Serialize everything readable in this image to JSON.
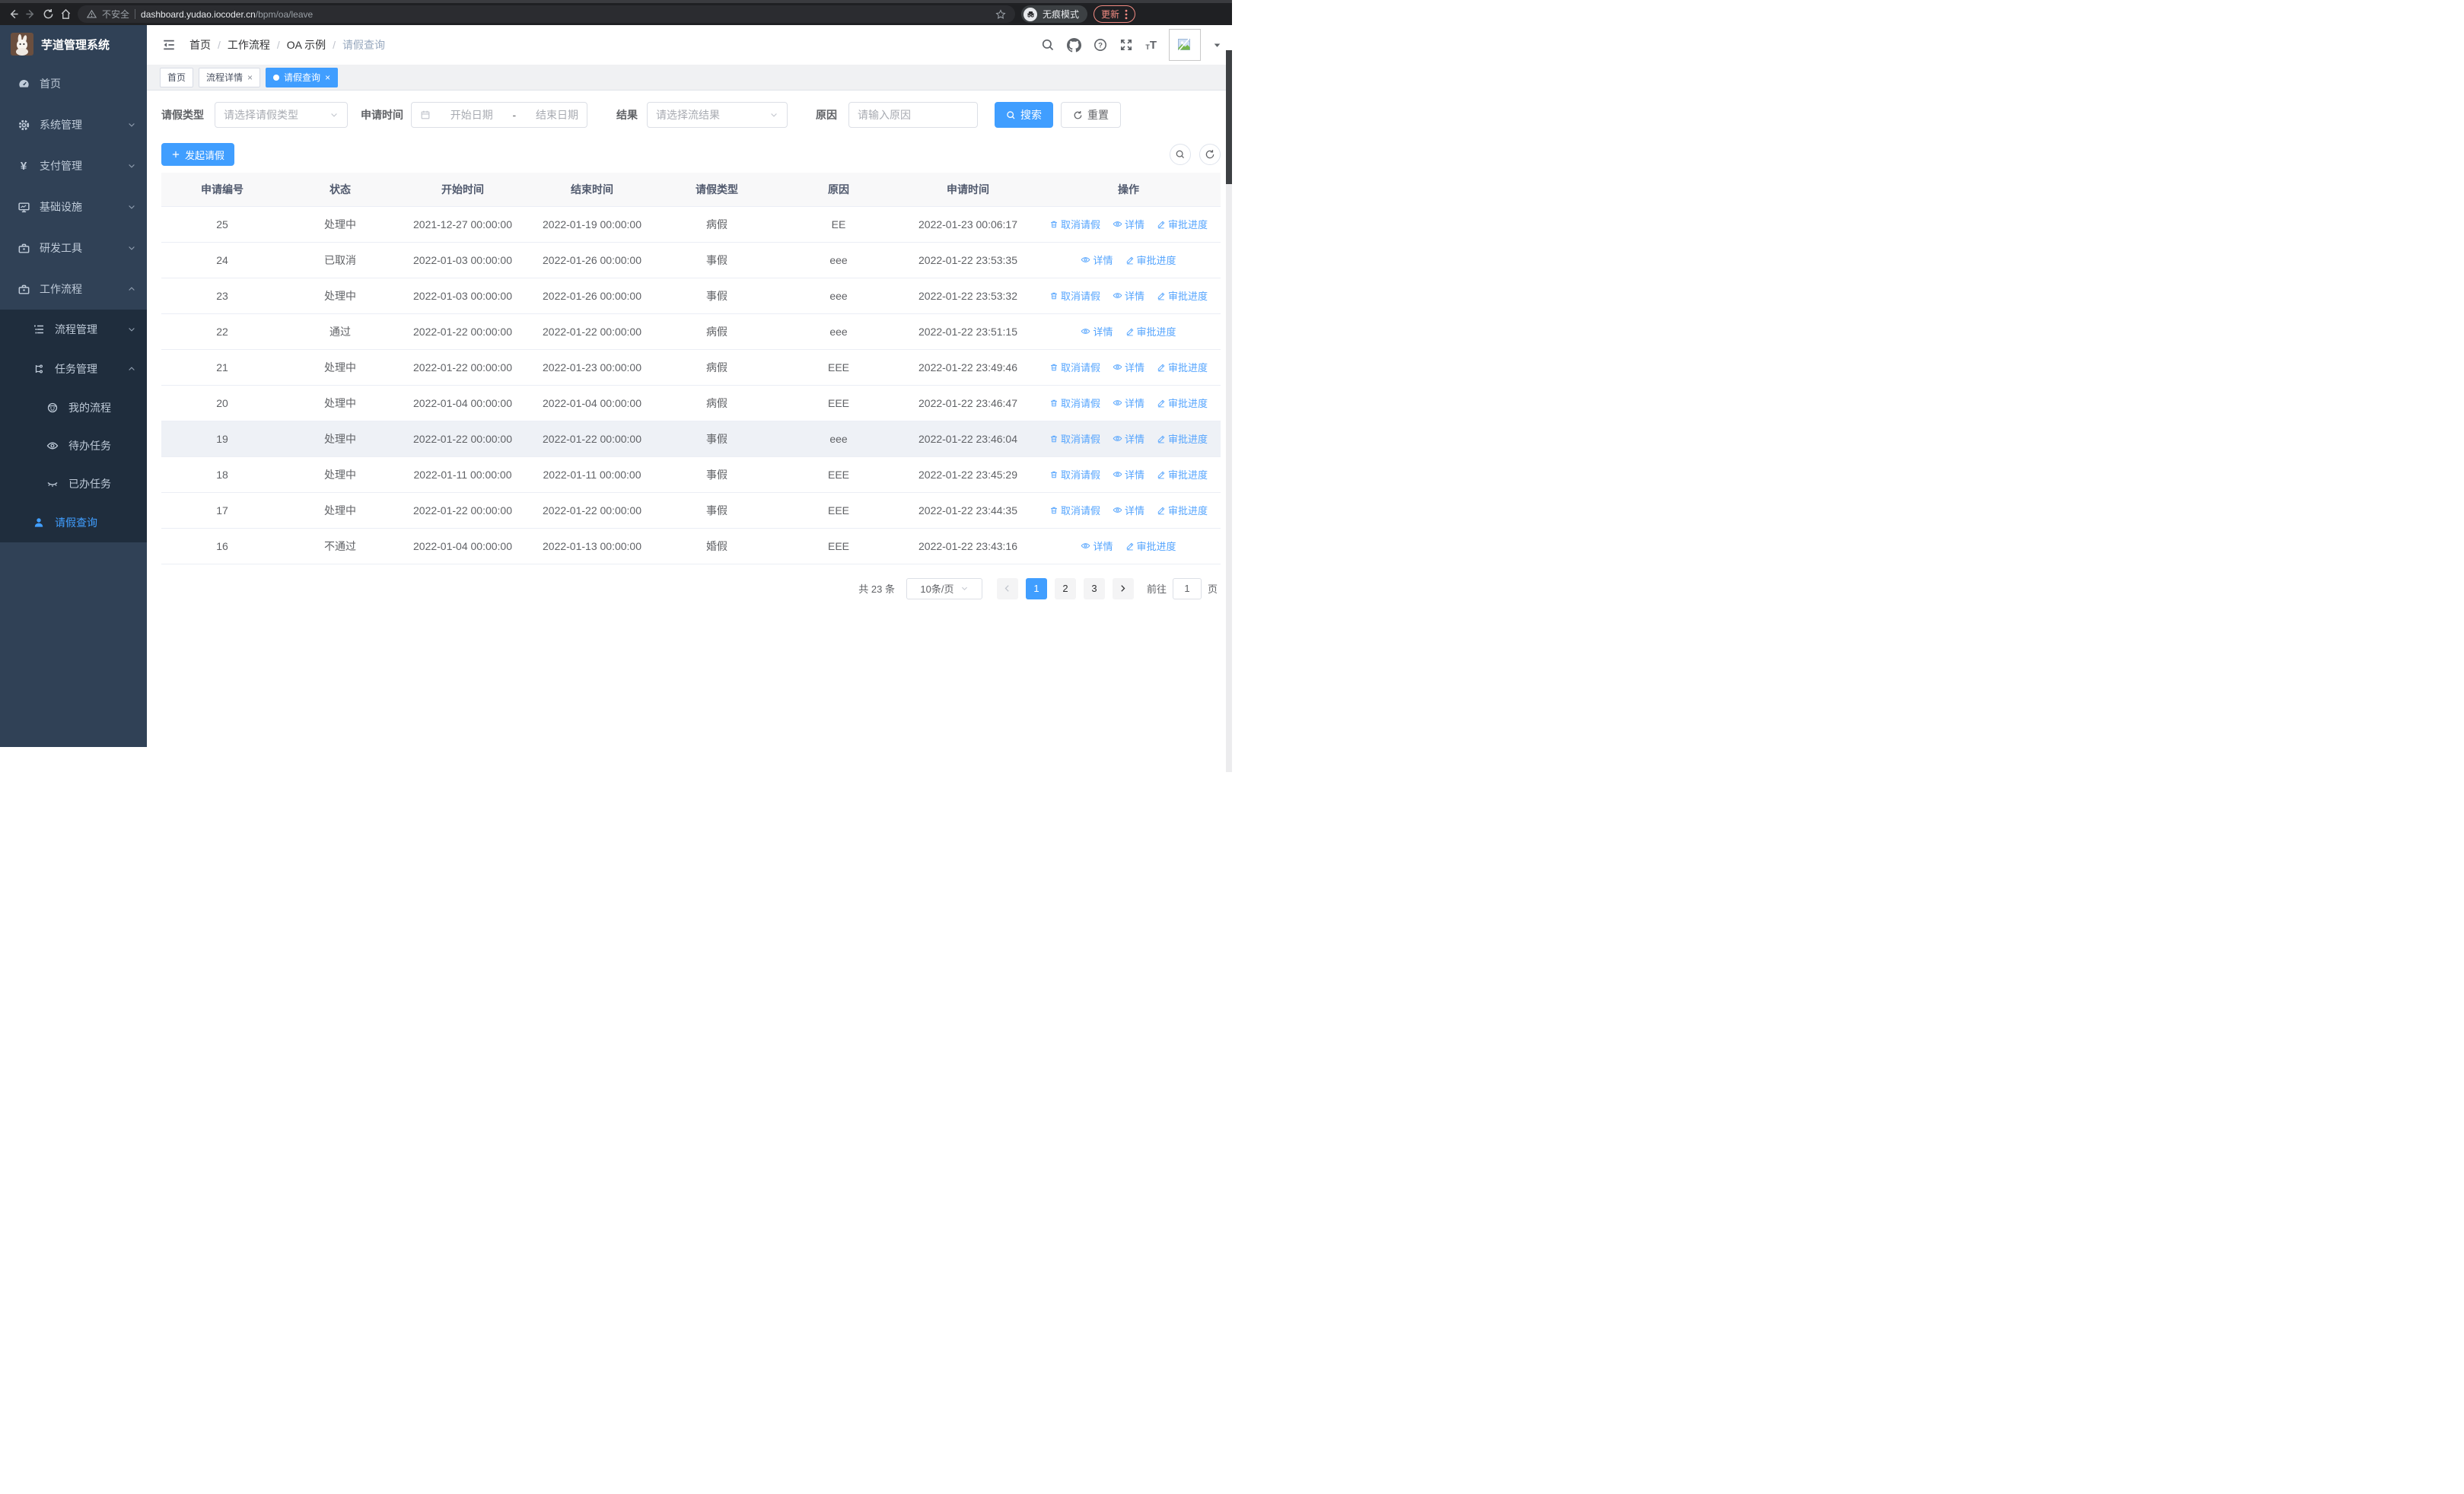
{
  "browser": {
    "security_label": "不安全",
    "url_host": "dashboard.yudao.iocoder.cn",
    "url_path": "/bpm/oa/leave",
    "incognito_label": "无痕模式",
    "update_label": "更新"
  },
  "colors": {
    "primary": "#409eff",
    "link": "#54a4fe",
    "sidebar_bg": "#304156",
    "submenu_bg": "#1f2d3d",
    "update_accent": "#f28b82"
  },
  "sidebar": {
    "title": "芋道管理系统",
    "items": [
      {
        "label": "首页",
        "icon": "dashboard-icon"
      },
      {
        "label": "系统管理",
        "icon": "gear-icon"
      },
      {
        "label": "支付管理",
        "icon": "yen-icon"
      },
      {
        "label": "基础设施",
        "icon": "monitor-icon"
      },
      {
        "label": "研发工具",
        "icon": "toolbox-icon"
      },
      {
        "label": "工作流程",
        "icon": "briefcase-icon",
        "children": [
          {
            "label": "流程管理",
            "icon": "tree-list-icon"
          },
          {
            "label": "任务管理",
            "icon": "flow-icon",
            "children": [
              {
                "label": "我的流程",
                "icon": "robot-icon"
              },
              {
                "label": "待办任务",
                "icon": "eye-open-icon"
              },
              {
                "label": "已办任务",
                "icon": "eye-closed-icon"
              }
            ]
          },
          {
            "label": "请假查询",
            "icon": "user-icon",
            "active": true
          }
        ]
      }
    ]
  },
  "header": {
    "breadcrumb": [
      "首页",
      "工作流程",
      "OA 示例",
      "请假查询"
    ]
  },
  "tabs": [
    {
      "label": "首页"
    },
    {
      "label": "流程详情",
      "closable": true
    },
    {
      "label": "请假查询",
      "closable": true,
      "active": true
    }
  ],
  "filters": {
    "leave_type_label": "请假类型",
    "leave_type_placeholder": "请选择请假类型",
    "apply_time_label": "申请时间",
    "start_placeholder": "开始日期",
    "range_separator": "-",
    "end_placeholder": "结束日期",
    "result_label": "结果",
    "result_placeholder": "请选择流结果",
    "reason_label": "原因",
    "reason_placeholder": "请输入原因",
    "search_label": "搜索",
    "reset_label": "重置"
  },
  "toolbar": {
    "create_label": "发起请假"
  },
  "table": {
    "columns": [
      "申请编号",
      "状态",
      "开始时间",
      "结束时间",
      "请假类型",
      "原因",
      "申请时间",
      "操作"
    ],
    "action_labels": {
      "cancel": "取消请假",
      "detail": "详情",
      "progress": "审批进度"
    },
    "rows": [
      {
        "id": "25",
        "status": "处理中",
        "start": "2021-12-27 00:00:00",
        "end": "2022-01-19 00:00:00",
        "type": "病假",
        "reason": "EE",
        "apply_time": "2022-01-23 00:06:17",
        "actions": [
          "cancel",
          "detail",
          "progress"
        ]
      },
      {
        "id": "24",
        "status": "已取消",
        "start": "2022-01-03 00:00:00",
        "end": "2022-01-26 00:00:00",
        "type": "事假",
        "reason": "eee",
        "apply_time": "2022-01-22 23:53:35",
        "actions": [
          "detail",
          "progress"
        ]
      },
      {
        "id": "23",
        "status": "处理中",
        "start": "2022-01-03 00:00:00",
        "end": "2022-01-26 00:00:00",
        "type": "事假",
        "reason": "eee",
        "apply_time": "2022-01-22 23:53:32",
        "actions": [
          "cancel",
          "detail",
          "progress"
        ]
      },
      {
        "id": "22",
        "status": "通过",
        "start": "2022-01-22 00:00:00",
        "end": "2022-01-22 00:00:00",
        "type": "病假",
        "reason": "eee",
        "apply_time": "2022-01-22 23:51:15",
        "actions": [
          "detail",
          "progress"
        ]
      },
      {
        "id": "21",
        "status": "处理中",
        "start": "2022-01-22 00:00:00",
        "end": "2022-01-23 00:00:00",
        "type": "病假",
        "reason": "EEE",
        "apply_time": "2022-01-22 23:49:46",
        "actions": [
          "cancel",
          "detail",
          "progress"
        ]
      },
      {
        "id": "20",
        "status": "处理中",
        "start": "2022-01-04 00:00:00",
        "end": "2022-01-04 00:00:00",
        "type": "病假",
        "reason": "EEE",
        "apply_time": "2022-01-22 23:46:47",
        "actions": [
          "cancel",
          "detail",
          "progress"
        ]
      },
      {
        "id": "19",
        "status": "处理中",
        "start": "2022-01-22 00:00:00",
        "end": "2022-01-22 00:00:00",
        "type": "事假",
        "reason": "eee",
        "apply_time": "2022-01-22 23:46:04",
        "actions": [
          "cancel",
          "detail",
          "progress"
        ],
        "highlighted": true
      },
      {
        "id": "18",
        "status": "处理中",
        "start": "2022-01-11 00:00:00",
        "end": "2022-01-11 00:00:00",
        "type": "事假",
        "reason": "EEE",
        "apply_time": "2022-01-22 23:45:29",
        "actions": [
          "cancel",
          "detail",
          "progress"
        ]
      },
      {
        "id": "17",
        "status": "处理中",
        "start": "2022-01-22 00:00:00",
        "end": "2022-01-22 00:00:00",
        "type": "事假",
        "reason": "EEE",
        "apply_time": "2022-01-22 23:44:35",
        "actions": [
          "cancel",
          "detail",
          "progress"
        ]
      },
      {
        "id": "16",
        "status": "不通过",
        "start": "2022-01-04 00:00:00",
        "end": "2022-01-13 00:00:00",
        "type": "婚假",
        "reason": "EEE",
        "apply_time": "2022-01-22 23:43:16",
        "actions": [
          "detail",
          "progress"
        ]
      }
    ]
  },
  "pagination": {
    "total": "共 23 条",
    "page_size": "10条/页",
    "pages": [
      "1",
      "2",
      "3"
    ],
    "active_page": "1",
    "goto_label": "前往",
    "goto_value": "1",
    "page_unit": "页"
  }
}
